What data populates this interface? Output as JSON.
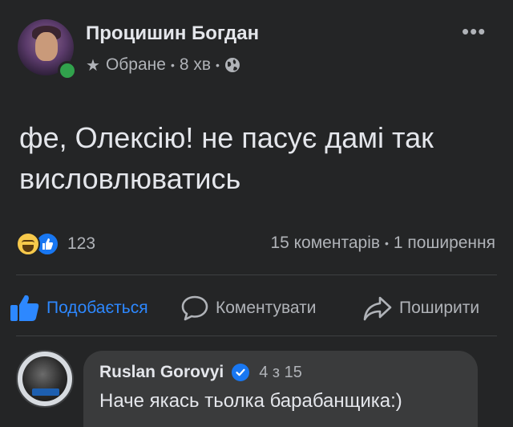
{
  "post": {
    "author": "Процишин Богдан",
    "audience": "Обране",
    "time": "8 хв",
    "separator": "•",
    "text": "фе, Олексію! не пасує дамі так висловлюватись"
  },
  "reactions": {
    "count": "123",
    "types": [
      "haha",
      "like"
    ],
    "comments": "15 коментарів",
    "shares": "1 поширення",
    "separator": "•"
  },
  "actions": {
    "like": "Подобається",
    "comment": "Коментувати",
    "share": "Поширити"
  },
  "comment": {
    "author": "Ruslan Gorovyi",
    "badge": "4 з 15",
    "text": "Наче якась тьолка барабанщика:)"
  },
  "colors": {
    "background": "#242526",
    "bubble": "#3a3b3c",
    "accent": "#2d88ff",
    "verified": "#1877f2",
    "online": "#31a24c",
    "muted": "#b0b3b8"
  },
  "icons": {
    "audience": "star-icon",
    "privacy": "globe-icon",
    "more": "more-options-icon",
    "like": "thumbs-up-icon",
    "comment": "comment-icon",
    "share": "share-arrow-icon"
  }
}
